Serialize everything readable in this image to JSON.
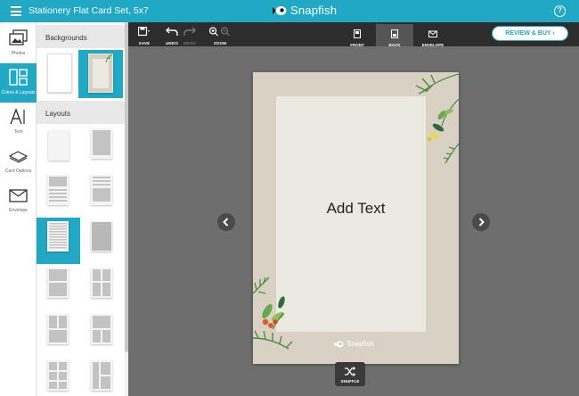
{
  "header": {
    "title": "Stationery Flat Card Set, 5x7",
    "brand": "Snapfish",
    "help": "?"
  },
  "rail": [
    {
      "label": "Photos",
      "icon": "photos-icon"
    },
    {
      "label": "Colors & Layouts",
      "icon": "layouts-icon",
      "active": true
    },
    {
      "label": "Text",
      "icon": "text-icon"
    },
    {
      "label": "Card Options",
      "icon": "card-options-icon"
    },
    {
      "label": "Envelope",
      "icon": "envelope-icon"
    }
  ],
  "panel": {
    "backgrounds_heading": "Backgrounds",
    "layouts_heading": "Layouts"
  },
  "toolbar": {
    "save": "SAVE",
    "undo": "UNDO",
    "redo": "REDO",
    "zoom": "ZOOM",
    "tabs": {
      "front": "FRONT",
      "back": "BACK",
      "envelope": "ENVELOPE"
    },
    "active_tab": "BACK",
    "review_buy": "REVIEW & BUY"
  },
  "canvas": {
    "add_text": "Add Text",
    "card_brand": "Snapfish",
    "shuffle": "SHUFFLE"
  },
  "colors": {
    "accent": "#21a8c4",
    "workspace": "#6e6e6e",
    "toolbar": "#2d2d2d"
  }
}
